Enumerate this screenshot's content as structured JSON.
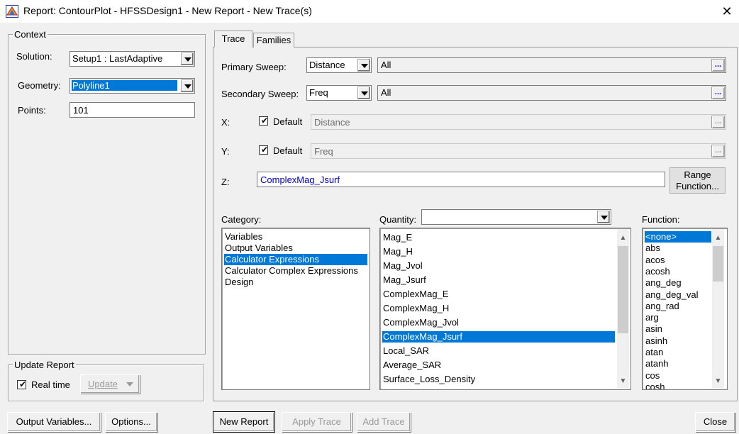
{
  "window": {
    "title": "Report: ContourPlot - HFSSDesign1 - New Report - New Trace(s)",
    "close_glyph": "✕"
  },
  "context": {
    "group_label": "Context",
    "solution_label": "Solution:",
    "solution_value": "Setup1 : LastAdaptive",
    "geometry_label": "Geometry:",
    "geometry_value": "Polyline1",
    "points_label": "Points:",
    "points_value": "101"
  },
  "update_report": {
    "group_label": "Update Report",
    "realtime_label": "Real time",
    "realtime_checked": true,
    "update_button": "Update"
  },
  "tabs": [
    {
      "label": "Trace",
      "active": true
    },
    {
      "label": "Families",
      "active": false
    }
  ],
  "trace": {
    "primary_sweep_label": "Primary Sweep:",
    "primary_sweep_value": "Distance",
    "primary_sweep_range": "All",
    "secondary_sweep_label": "Secondary Sweep:",
    "secondary_sweep_value": "Freq",
    "secondary_sweep_range": "All",
    "x_label": "X:",
    "x_default_label": "Default",
    "x_value": "Distance",
    "y_label": "Y:",
    "y_default_label": "Default",
    "y_value": "Freq",
    "z_label": "Z:",
    "z_value": "ComplexMag_Jsurf",
    "range_function_line1": "Range",
    "range_function_line2": "Function...",
    "ellipsis": "..."
  },
  "category": {
    "label": "Category:",
    "items": [
      "Variables",
      "Output Variables",
      "Calculator Expressions",
      "Calculator Complex Expressions",
      "Design"
    ],
    "selected_index": 2
  },
  "quantity": {
    "label": "Quantity:",
    "filter_value": "",
    "items": [
      "Mag_E",
      "Mag_H",
      "Mag_Jvol",
      "Mag_Jsurf",
      "ComplexMag_E",
      "ComplexMag_H",
      "ComplexMag_Jvol",
      "ComplexMag_Jsurf",
      "Local_SAR",
      "Average_SAR",
      "Surface_Loss_Density"
    ],
    "selected_index": 7
  },
  "function": {
    "label": "Function:",
    "items": [
      "<none>",
      "abs",
      "acos",
      "acosh",
      "ang_deg",
      "ang_deg_val",
      "ang_rad",
      "arg",
      "asin",
      "asinh",
      "atan",
      "atanh",
      "cos",
      "cosh"
    ],
    "selected_index": 0
  },
  "bottom_buttons": {
    "output_variables": "Output Variables...",
    "options": "Options...",
    "new_report": "New Report",
    "apply_trace": "Apply Trace",
    "add_trace": "Add Trace",
    "close": "Close"
  }
}
